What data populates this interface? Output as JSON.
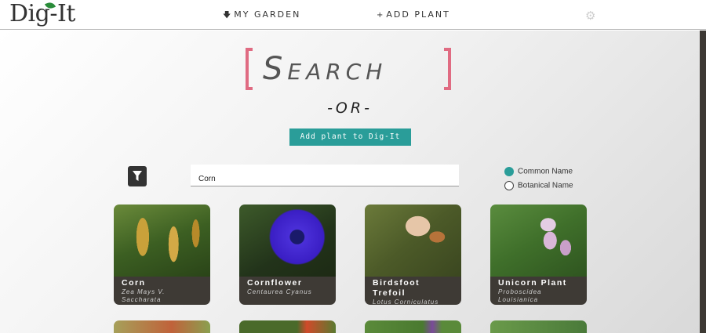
{
  "header": {
    "logo_text": "Dig-It",
    "nav": {
      "my_garden": {
        "icon": "down-arrow-icon",
        "label": "MY GARDEN"
      },
      "add_plant": {
        "icon": "plus-icon",
        "label": "ADD PLANT"
      }
    },
    "settings_icon": "gear-icon"
  },
  "main": {
    "search_heading": "Search",
    "or_text": "-OR-",
    "add_button_label": "Add plant to Dig-It",
    "filter_icon": "filter-icon",
    "search_input_value": "Corn",
    "search_mode": {
      "options": [
        {
          "label": "Common Name",
          "selected": true
        },
        {
          "label": "Botanical Name",
          "selected": false
        }
      ]
    },
    "accent_color": "#2a9d99",
    "bracket_color": "#e06b82",
    "results": [
      {
        "common_name": "Corn",
        "scientific_name": "Zea Mays V. Saccharata"
      },
      {
        "common_name": "Cornflower",
        "scientific_name": "Centaurea Cyanus"
      },
      {
        "common_name": "Birdsfoot Trefoil",
        "scientific_name": "Lotus Corniculatus"
      },
      {
        "common_name": "Unicorn Plant",
        "scientific_name": "Proboscidea Louisianica"
      }
    ]
  }
}
